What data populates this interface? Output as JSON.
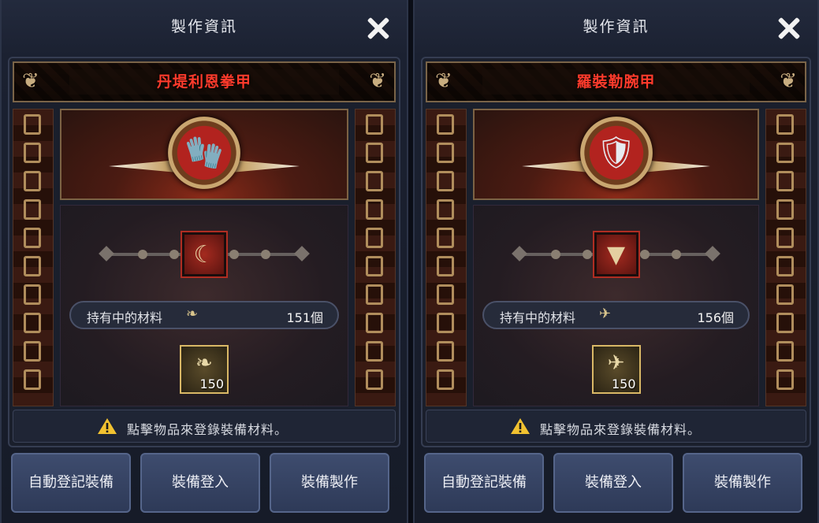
{
  "panels": [
    {
      "title": "製作資訊",
      "item_name": "丹堤利恩拳甲",
      "item_icon": "gauntlet-icon",
      "material_icon": "claw-icon",
      "held_label": "持有中的材料",
      "held_count": "151個",
      "output_quantity": "150",
      "notice": "點擊物品來登錄裝備材料。",
      "buttons": [
        "自動登記裝備",
        "裝備登入",
        "裝備製作"
      ]
    },
    {
      "title": "製作資訊",
      "item_name": "羅裝勒腕甲",
      "item_icon": "bracer-icon",
      "material_icon": "fang-icon",
      "held_label": "持有中的材料",
      "held_count": "156個",
      "output_quantity": "150",
      "notice": "點擊物品來登錄裝備材料。",
      "buttons": [
        "自動登記裝備",
        "裝備登入",
        "裝備製作"
      ]
    }
  ],
  "colors": {
    "item_name": "#ff3b2c",
    "warning": "#f2c230"
  }
}
